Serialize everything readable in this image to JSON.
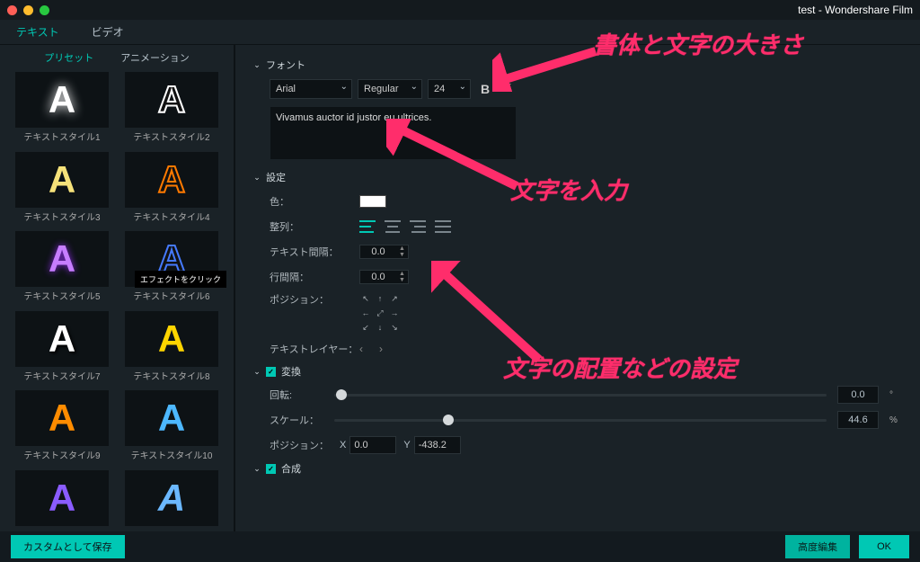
{
  "title": "test - Wondershare Film",
  "mainTabs": {
    "text": "テキスト",
    "video": "ビデオ"
  },
  "subTabs": {
    "preset": "プリセット",
    "anim": "アニメーション"
  },
  "presets": [
    {
      "label": "テキストスタイル1"
    },
    {
      "label": "テキストスタイル2"
    },
    {
      "label": "テキストスタイル3"
    },
    {
      "label": "テキストスタイル4"
    },
    {
      "label": "テキストスタイル5"
    },
    {
      "label": "テキストスタイル6"
    },
    {
      "label": "テキストスタイル7"
    },
    {
      "label": "テキストスタイル8"
    },
    {
      "label": "テキストスタイル9"
    },
    {
      "label": "テキストスタイル10"
    },
    {
      "label": ""
    },
    {
      "label": ""
    }
  ],
  "tooltip": "エフェクトをクリック",
  "font": {
    "section": "フォント",
    "family": "Arial",
    "weight": "Regular",
    "size": "24",
    "text": "Vivamus auctor id justor eu ultrices."
  },
  "settings": {
    "section": "設定",
    "colorLabel": "色：",
    "alignLabel": "整列：",
    "textSpacingLabel": "テキスト間隔：",
    "textSpacingVal": "0.0",
    "lineSpacingLabel": "行間隔：",
    "lineSpacingVal": "0.0",
    "positionLabel": "ポジション：",
    "layerLabel": "テキストレイヤー："
  },
  "transform": {
    "section": "変換",
    "rotationLabel": "回転:",
    "rotationVal": "0.0",
    "rotationUnit": "°",
    "scaleLabel": "スケール：",
    "scaleVal": "44.6",
    "scaleUnit": "%",
    "posLabel": "ポジション：",
    "xLabel": "X",
    "xVal": "0.0",
    "yLabel": "Y",
    "yVal": "-438.2"
  },
  "compose": {
    "section": "合成"
  },
  "footer": {
    "saveCustom": "カスタムとして保存",
    "advanced": "高度編集",
    "ok": "OK"
  },
  "annotations": {
    "a1": "書体と文字の大きさ",
    "a2": "文字を入力",
    "a3": "文字の配置などの設定"
  }
}
